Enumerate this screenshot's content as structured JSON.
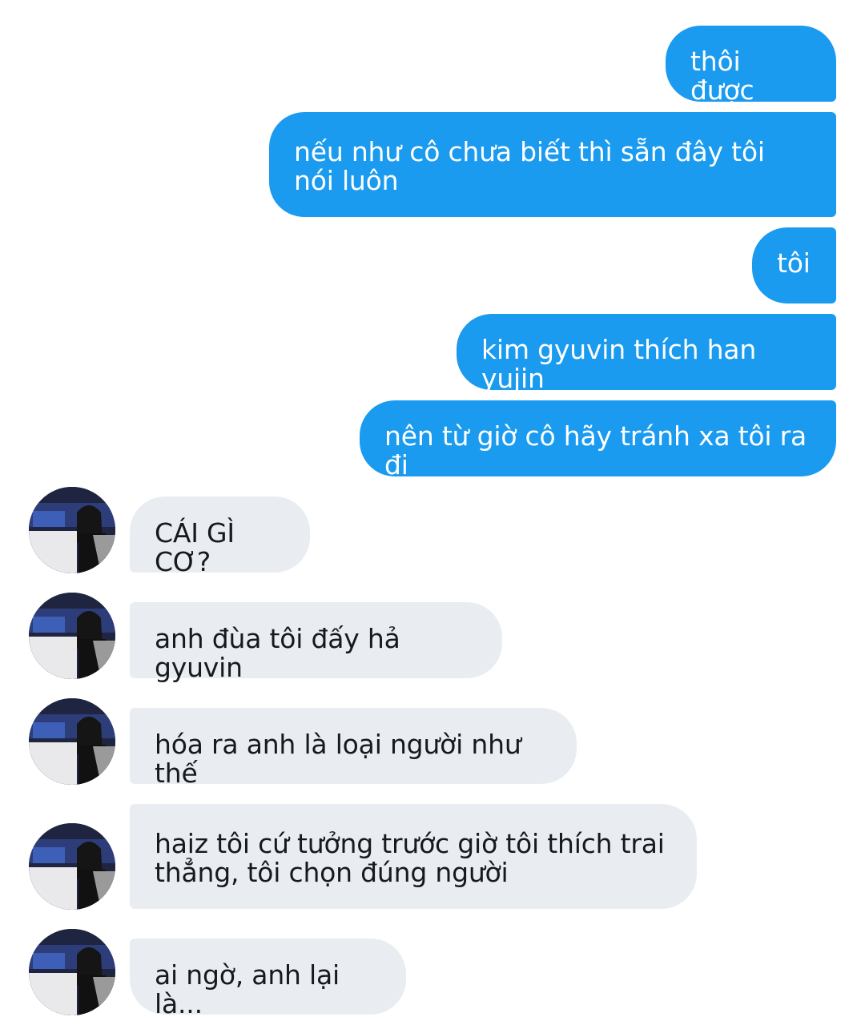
{
  "messages": {
    "outgoing": [
      {
        "text": "thôi được"
      },
      {
        "text": "nếu như cô chưa biết thì sẵn đây tôi nói luôn"
      },
      {
        "text": "tôi"
      },
      {
        "text": "kim gyuvin thích han yujin"
      },
      {
        "text": "nên từ giờ cô hãy tránh xa tôi ra đi"
      }
    ],
    "incoming": [
      {
        "text": "CÁI GÌ CƠ?"
      },
      {
        "text": "anh đùa tôi đấy hả gyuvin"
      },
      {
        "text": "hóa ra anh là loại người như thế"
      },
      {
        "text": "haiz tôi cứ tưởng trước giờ tôi thích trai thẳng, tôi chọn đúng người"
      },
      {
        "text": "ai ngờ, anh lại là..."
      }
    ]
  },
  "colors": {
    "outgoing_bubble": "#1a9bef",
    "incoming_bubble": "#e9edf2",
    "outgoing_text": "#ffffff",
    "incoming_text": "#161a1f"
  },
  "icons": {
    "avatar": "contact-avatar-photo"
  }
}
